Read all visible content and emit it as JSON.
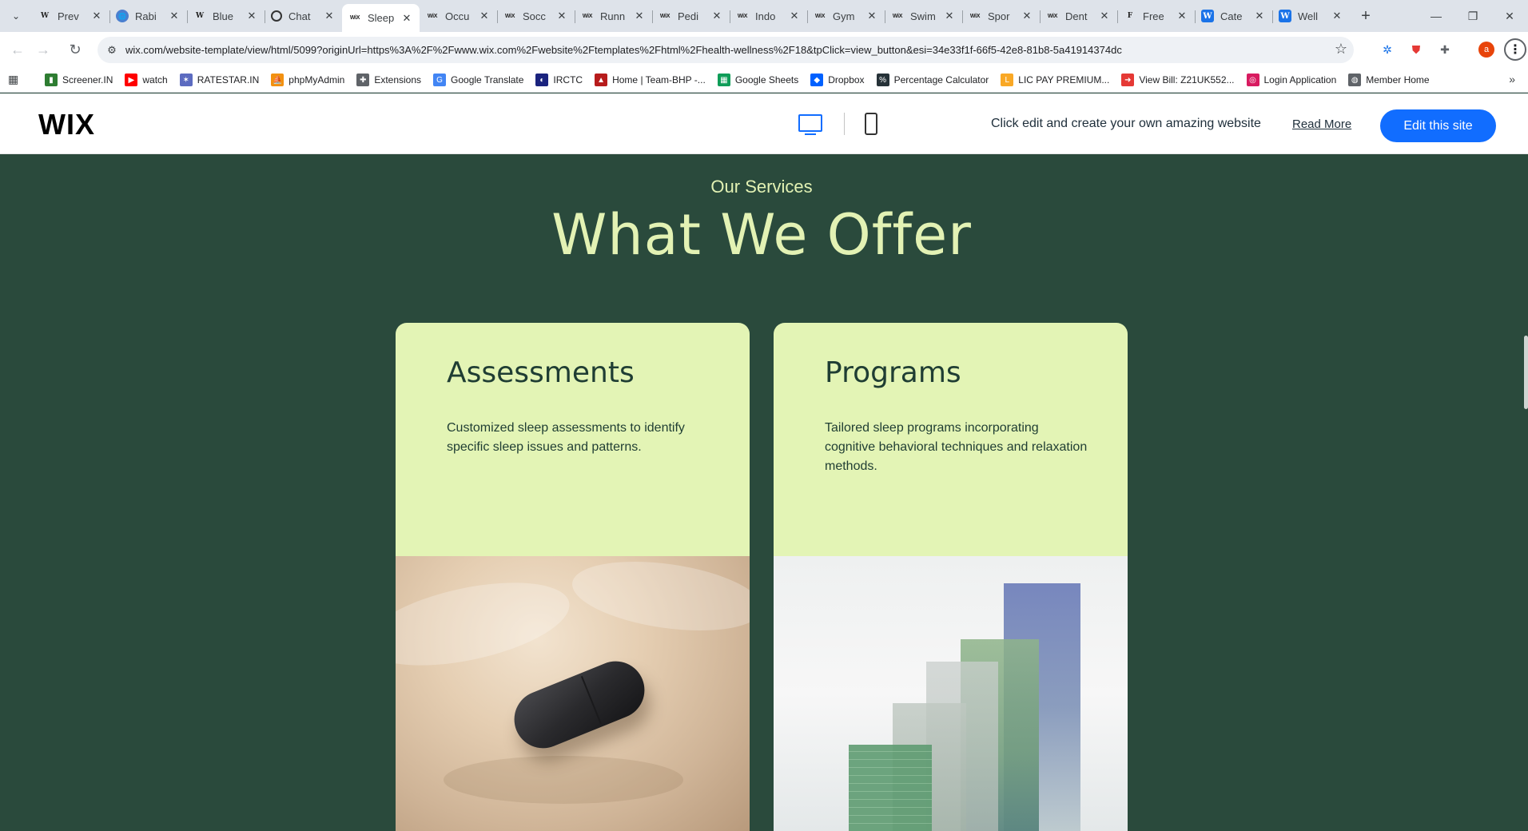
{
  "browser": {
    "tabs": [
      {
        "title": "Prev",
        "favicon": "W",
        "style": "wiki"
      },
      {
        "title": "Rabi",
        "favicon": "🌐",
        "style": "globe"
      },
      {
        "title": "Blue",
        "favicon": "W",
        "style": "wiki"
      },
      {
        "title": "Chat",
        "favicon": "",
        "style": "gpt"
      },
      {
        "title": "Sleep",
        "favicon": "WiX",
        "style": "wix",
        "active": true
      },
      {
        "title": "Occu",
        "favicon": "WiX",
        "style": "wix"
      },
      {
        "title": "Socc",
        "favicon": "WiX",
        "style": "wix"
      },
      {
        "title": "Runn",
        "favicon": "WiX",
        "style": "wix"
      },
      {
        "title": "Pedi",
        "favicon": "WiX",
        "style": "wix"
      },
      {
        "title": "Indo",
        "favicon": "WiX",
        "style": "wix"
      },
      {
        "title": "Gym",
        "favicon": "WiX",
        "style": "wix"
      },
      {
        "title": "Swim",
        "favicon": "WiX",
        "style": "wix"
      },
      {
        "title": "Spor",
        "favicon": "WiX",
        "style": "wix"
      },
      {
        "title": "Dent",
        "favicon": "WiX",
        "style": "wix"
      },
      {
        "title": "Free",
        "favicon": "F",
        "style": "wiki"
      },
      {
        "title": "Cate",
        "favicon": "W",
        "style": "blue"
      },
      {
        "title": "Well",
        "favicon": "W",
        "style": "blue"
      }
    ],
    "new_tab": "+",
    "window_controls": {
      "minimize": "—",
      "restore": "❐",
      "close": "✕"
    },
    "url": "wix.com/website-template/view/html/5099?originUrl=https%3A%2F%2Fwww.wix.com%2Fwebsite%2Ftemplates%2Fhtml%2Fhealth-wellness%2F18&tpClick=view_button&esi=34e33f1f-66f5-42e8-81b8-5a41914374dc",
    "profile_initial": "a",
    "bookmarks": [
      {
        "label": "Screener.IN",
        "icon": "bar-chart-icon",
        "color": "#2e7d32",
        "glyph": "▮"
      },
      {
        "label": "watch",
        "icon": "youtube-icon",
        "color": "#ff0000",
        "glyph": "▶"
      },
      {
        "label": "RATESTAR.IN",
        "icon": "ratestar-icon",
        "color": "#5c6bc0",
        "glyph": "✶"
      },
      {
        "label": "phpMyAdmin",
        "icon": "phpmyadmin-icon",
        "color": "#f29111",
        "glyph": "⛵"
      },
      {
        "label": "Extensions",
        "icon": "puzzle-icon",
        "color": "#5f6368",
        "glyph": "✚"
      },
      {
        "label": "Google Translate",
        "icon": "translate-icon",
        "color": "#4285f4",
        "glyph": "G"
      },
      {
        "label": "IRCTC",
        "icon": "irctc-icon",
        "color": "#1a237e",
        "glyph": "◐"
      },
      {
        "label": "Home | Team-BHP -...",
        "icon": "teambhp-icon",
        "color": "#b71c1c",
        "glyph": "▲"
      },
      {
        "label": "Google Sheets",
        "icon": "sheets-icon",
        "color": "#0f9d58",
        "glyph": "▦"
      },
      {
        "label": "Dropbox",
        "icon": "dropbox-icon",
        "color": "#0061ff",
        "glyph": "◆"
      },
      {
        "label": "Percentage Calculator",
        "icon": "percent-icon",
        "color": "#263238",
        "glyph": "%"
      },
      {
        "label": "LIC PAY PREMIUM...",
        "icon": "lic-icon",
        "color": "#f9a825",
        "glyph": "L"
      },
      {
        "label": "View Bill: Z21UK552...",
        "icon": "bill-icon",
        "color": "#e53935",
        "glyph": "➜"
      },
      {
        "label": "Login Application",
        "icon": "login-icon",
        "color": "#d81b60",
        "glyph": "◎"
      },
      {
        "label": "Member Home",
        "icon": "globe-icon",
        "color": "#5f6368",
        "glyph": "◍"
      }
    ]
  },
  "wix_header": {
    "logo": "WIX",
    "tagline": "Click edit and create your own amazing website",
    "read_more": "Read More",
    "edit_button": "Edit this site"
  },
  "services": {
    "subtitle": "Our Services",
    "title": "What We Offer",
    "cards": [
      {
        "title": "Assessments",
        "description": "Customized sleep assessments to identify specific sleep issues and patterns.",
        "image": "sleep-tracker-on-bed"
      },
      {
        "title": "Programs",
        "description": "Tailored sleep programs incorporating cognitive behavioral techniques and relaxation methods.",
        "image": "translucent-bar-chart-sculpture"
      }
    ]
  },
  "colors": {
    "page_bg": "#2a4a3c",
    "card_bg": "#e3f4b5",
    "heading_accent": "#e3f2b4",
    "wix_blue": "#116dff"
  }
}
